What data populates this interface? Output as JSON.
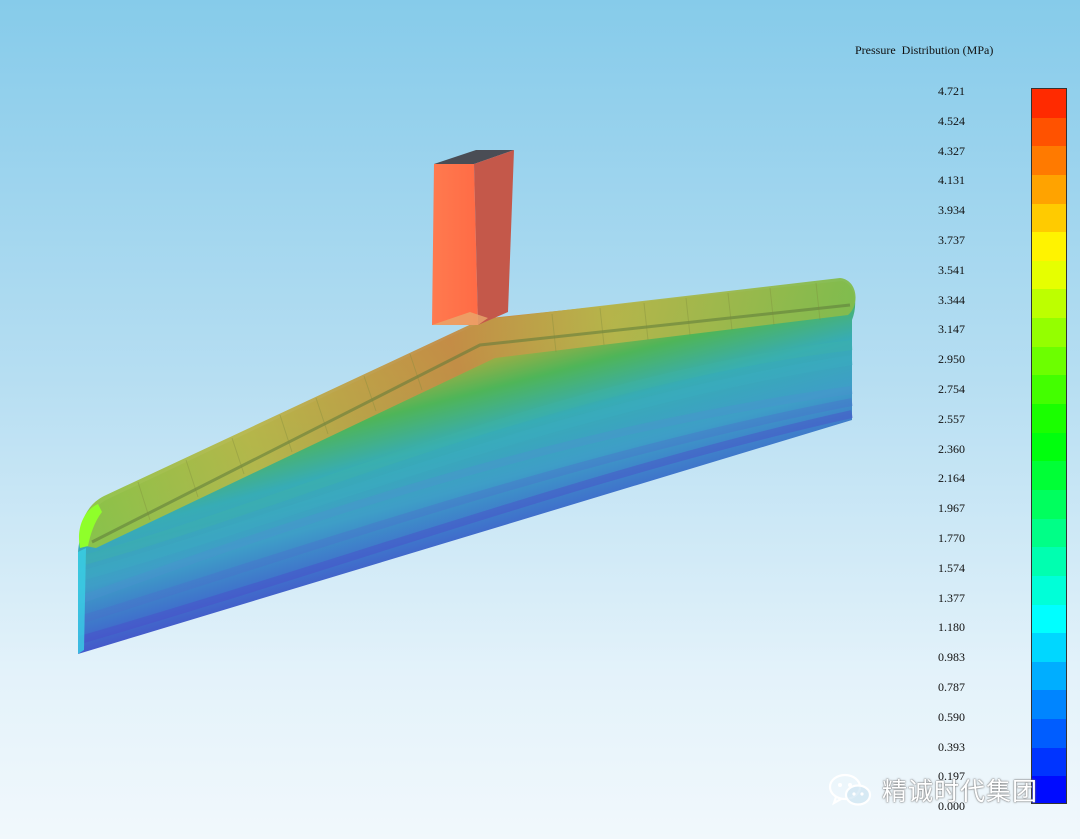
{
  "legend": {
    "title": "Pressure  Distribution (MPa)",
    "ticks": [
      "4.721",
      "4.524",
      "4.327",
      "4.131",
      "3.934",
      "3.737",
      "3.541",
      "3.344",
      "3.147",
      "2.950",
      "2.754",
      "2.557",
      "2.360",
      "2.164",
      "1.967",
      "1.770",
      "1.574",
      "1.377",
      "1.180",
      "0.983",
      "0.787",
      "0.590",
      "0.393",
      "0.197",
      "0.000"
    ],
    "colors": [
      "#ff2a00",
      "#ff5200",
      "#ff7a00",
      "#ffa300",
      "#ffcb00",
      "#fff300",
      "#e6ff00",
      "#bdff00",
      "#94ff00",
      "#6cff00",
      "#43ff00",
      "#1aff00",
      "#00ff0d",
      "#00ff36",
      "#00ff5e",
      "#00ff87",
      "#00ffb0",
      "#00ffd8",
      "#00ffff",
      "#00d7ff",
      "#00aeff",
      "#0085ff",
      "#005dff",
      "#0034ff",
      "#000bff"
    ]
  },
  "watermark": {
    "text": "精诚时代集团",
    "icon": "wechat-icon"
  }
}
